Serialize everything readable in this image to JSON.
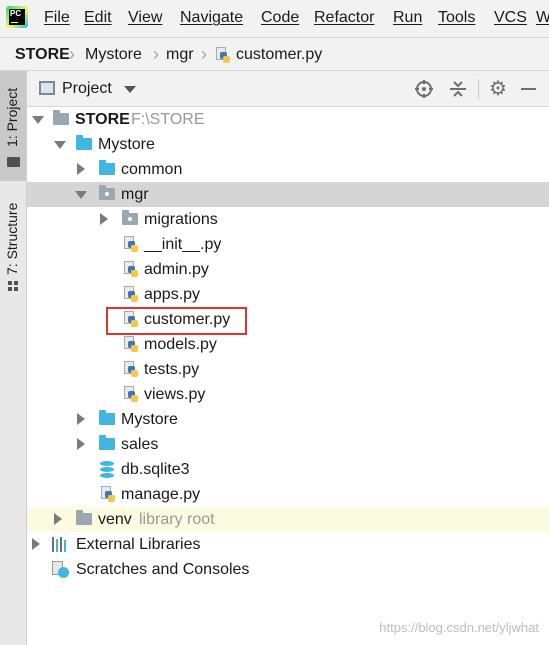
{
  "menubar": {
    "logo_text": "PC",
    "items": [
      "File",
      "Edit",
      "View",
      "Navigate",
      "Code",
      "Refactor",
      "Run",
      "Tools",
      "VCS",
      "Wh"
    ]
  },
  "breadcrumb": {
    "items": [
      "STORE",
      "Mystore",
      "mgr",
      "customer.py"
    ]
  },
  "toolwindow_strip": {
    "project_tab": "1: Project",
    "structure_tab": "7: Structure"
  },
  "panel": {
    "title": "Project"
  },
  "tree": {
    "store": {
      "label": "STORE",
      "path": "F:\\STORE"
    },
    "mystore": "Mystore",
    "common": "common",
    "mgr": "mgr",
    "migrations": "migrations",
    "init": "__init__.py",
    "admin": "admin.py",
    "apps": "apps.py",
    "customer": "customer.py",
    "models": "models.py",
    "tests": "tests.py",
    "views": "views.py",
    "mystore2": "Mystore",
    "sales": "sales",
    "db": "db.sqlite3",
    "manage": "manage.py",
    "venv": {
      "label": "venv",
      "hint": "library root"
    },
    "external": "External Libraries",
    "scratches": "Scratches and Consoles"
  },
  "watermark": "https://blog.csdn.net/yljwhat",
  "colors": {
    "selection": "#d5d5d5",
    "highlight_box": "#e03434",
    "folder_blue": "#40b6e0",
    "folder_gray": "#9aa7b0",
    "venv_row": "#fbfbe2"
  }
}
